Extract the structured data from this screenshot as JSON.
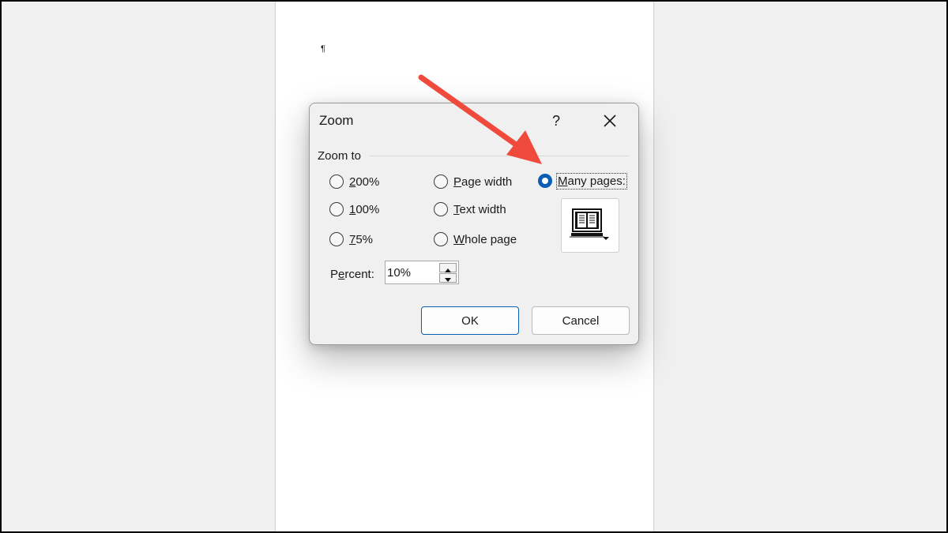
{
  "dialog": {
    "title": "Zoom",
    "help_label": "?",
    "zoom_to_label": "Zoom to",
    "options": [
      {
        "label": "200%",
        "mnemonic_index": 0,
        "selected": false
      },
      {
        "label": "100%",
        "mnemonic_index": 0,
        "selected": false
      },
      {
        "label": "75%",
        "mnemonic_index": 0,
        "selected": false
      },
      {
        "label": "Page width",
        "mnemonic_index": 0,
        "selected": false
      },
      {
        "label": "Text width",
        "mnemonic_index": 0,
        "selected": false
      },
      {
        "label": "Whole page",
        "mnemonic_index": 0,
        "selected": false
      },
      {
        "label": "Many pages:",
        "mnemonic_index": 0,
        "selected": true
      }
    ],
    "many_pages_button_icon": "monitor-pages-icon",
    "percent_label": "Percent:",
    "percent_value": "10%",
    "ok_label": "OK",
    "cancel_label": "Cancel"
  },
  "document": {
    "paragraph_mark": "¶"
  },
  "colors": {
    "accent": "#0a5fb4",
    "annotation_arrow": "#f04a3c"
  }
}
